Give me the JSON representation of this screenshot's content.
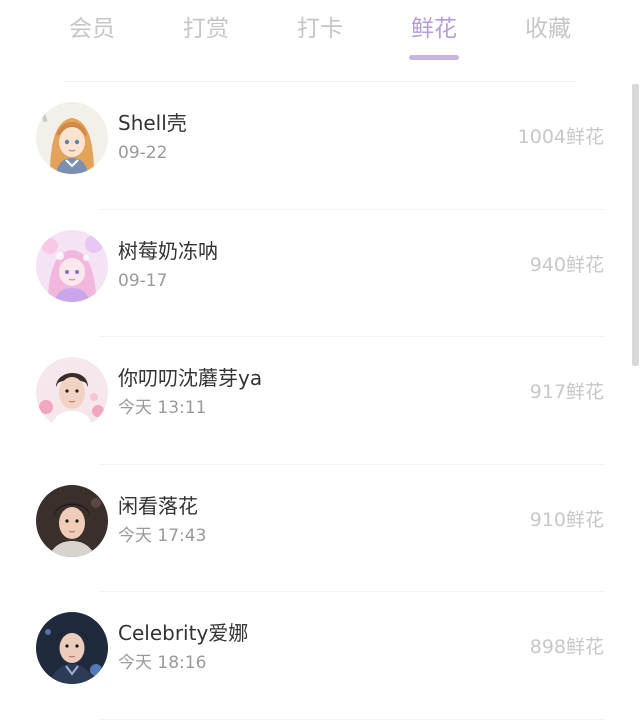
{
  "tabs": {
    "items": [
      {
        "label": "会员"
      },
      {
        "label": "打赏"
      },
      {
        "label": "打卡"
      },
      {
        "label": "鲜花"
      },
      {
        "label": "收藏"
      }
    ],
    "active_color": "#b89bdb",
    "inactive_color": "#c6c6c6"
  },
  "rows": [
    {
      "name": "Shell壳",
      "time": "09-22",
      "flowers": "1004鲜花"
    },
    {
      "name": "树莓奶冻呐",
      "time": "09-17",
      "flowers": "940鲜花"
    },
    {
      "name": "你叨叨沈蘑芽ya",
      "time": "今天 13:11",
      "flowers": "917鲜花"
    },
    {
      "name": "闲看落花",
      "time": "今天 17:43",
      "flowers": "910鲜花"
    },
    {
      "name": "Celebrity爱娜",
      "time": "今天 18:16",
      "flowers": "898鲜花"
    }
  ]
}
